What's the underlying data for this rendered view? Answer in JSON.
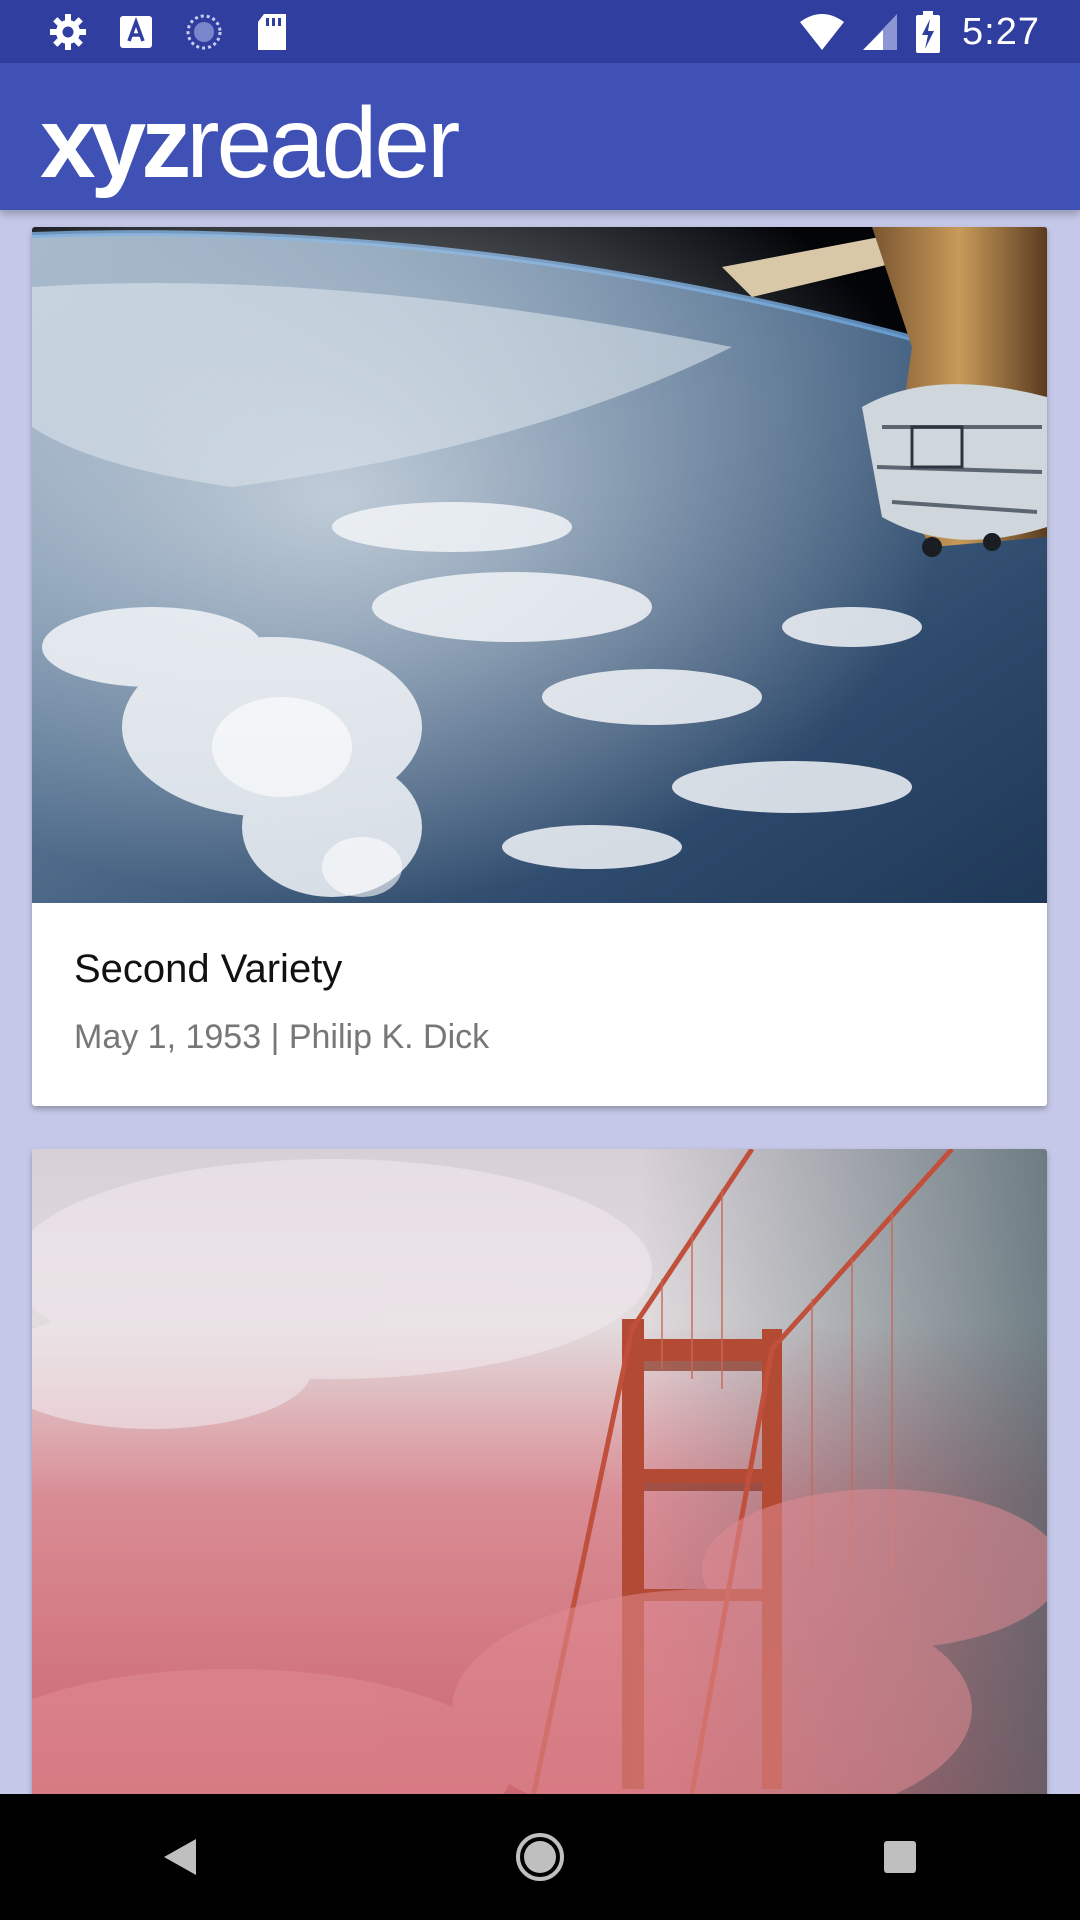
{
  "status_bar": {
    "time": "5:27",
    "icons": [
      "settings-icon",
      "font-a-icon",
      "sync-circle-icon",
      "sd-card-icon",
      "wifi-icon",
      "signal-icon",
      "battery-charging-icon"
    ]
  },
  "app_bar": {
    "logo_bold": "xyz",
    "logo_light": "reader"
  },
  "articles": [
    {
      "title": "Second Variety",
      "subtitle": "May 1, 1953 | Philip K. Dick",
      "image": "earth-from-space-photo"
    },
    {
      "title": "",
      "subtitle": "",
      "image": "golden-gate-bridge-fog-photo"
    }
  ],
  "nav_bar": {
    "buttons": [
      "back-icon",
      "home-icon",
      "recents-icon"
    ]
  },
  "colors": {
    "primary": "#3f51b5",
    "primary_dark": "#303f9f",
    "background": "#c5c8e8"
  }
}
